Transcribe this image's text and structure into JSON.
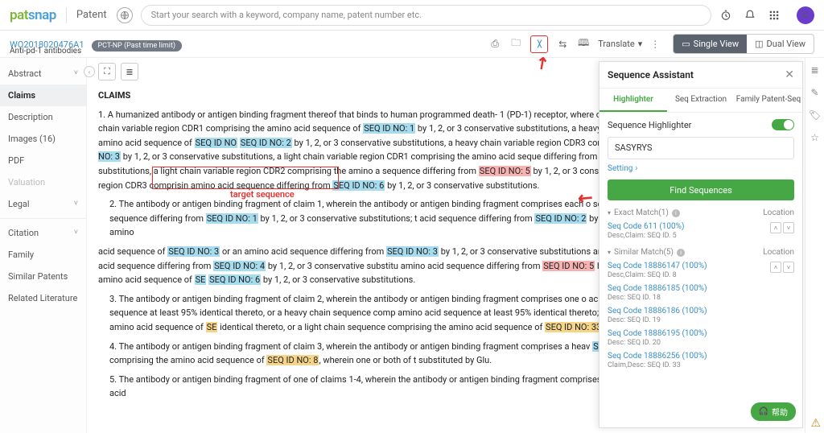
{
  "brand": {
    "logo_part1": "pat",
    "logo_part2": "snap",
    "section": "Patent"
  },
  "search": {
    "placeholder": "Start your search with a keyword, company name, patent number etc."
  },
  "avatar_initial": "C",
  "patent": {
    "pubnum": "WO2018020476A1",
    "status_tag": "PCT-NP (Past time limit)",
    "title": "Anti-pd-1 antibodies"
  },
  "toolbar": {
    "translate": "Translate",
    "single_view": "Single View",
    "dual_view": "Dual View"
  },
  "sidebar": {
    "items": [
      {
        "label": "Abstract",
        "expandable": true
      },
      {
        "label": "Claims",
        "active": true
      },
      {
        "label": "Description"
      },
      {
        "label": "Images (16)"
      },
      {
        "label": "PDF"
      },
      {
        "label": "Valuation",
        "muted": true
      },
      {
        "label": "Legal",
        "expandable": true
      }
    ],
    "items2": [
      {
        "label": "Citation",
        "expandable": true
      },
      {
        "label": "Family"
      },
      {
        "label": "Similar Patents"
      },
      {
        "label": "Related Literature"
      }
    ]
  },
  "claims": {
    "heading": "CLAIMS"
  },
  "annotation": {
    "target_label": "target sequence"
  },
  "panel": {
    "title": "Sequence Assistant",
    "tabs": [
      "Highlighter",
      "Seq Extraction",
      "Family Patent-Seq"
    ],
    "active_tab": 0,
    "hl_label": "Sequence Highlighter",
    "input_value": "SASYRYS",
    "setting": "Setting",
    "find_btn": "Find Sequences",
    "exact": {
      "header": "Exact Match(1)",
      "location": "Location",
      "items": [
        {
          "code": "Seq Code 611 (100%)",
          "desc": "Desc,Claim: SEQ ID. 5"
        }
      ]
    },
    "similar": {
      "header": "Similar Match(5)",
      "location": "Location",
      "items": [
        {
          "code": "Seq Code 18886147 (100%)",
          "desc": "Desc,Claim: SEQ ID. 8"
        },
        {
          "code": "Seq Code 18886185 (100%)",
          "desc": "Desc: SEQ ID. 18"
        },
        {
          "code": "Seq Code 18886186 (100%)",
          "desc": "Desc: SEQ ID. 19"
        },
        {
          "code": "Seq Code 18886195 (100%)",
          "desc": "Desc: SEQ ID. 20"
        },
        {
          "code": "Seq Code 18886256 (100%)",
          "desc": "Claim,Desc: SEQ ID. 33"
        }
      ]
    },
    "help": "帮助"
  }
}
